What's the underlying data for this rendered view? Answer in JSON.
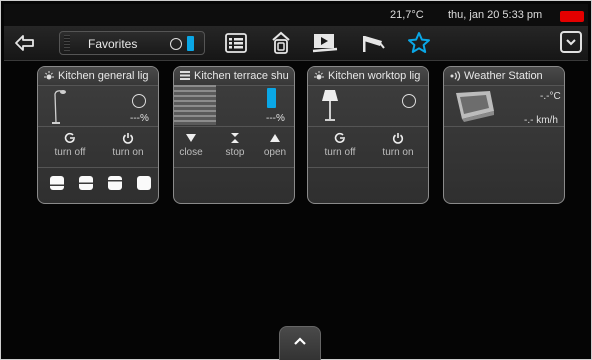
{
  "status_bar": {
    "temperature": "21,7°C",
    "datetime": "thu, jan 20  5:33 pm",
    "battery_color": "#e30000"
  },
  "toolbar": {
    "back_icon": "back-arrow-icon",
    "favorites_select": {
      "value": "Favorites"
    },
    "nav_icons": [
      "list-icon",
      "home-icon",
      "media-player-icon",
      "camera-icon",
      "star-icon"
    ],
    "active_icon": "star-icon",
    "active_color": "#0aa7e6",
    "menu_icon": "chevron-down-icon"
  },
  "cards": [
    {
      "title": "Kitchen general lig",
      "icon": "light-bulb-icon",
      "value": "---%",
      "actions": [
        {
          "icon": "power-off-icon",
          "label": "turn off"
        },
        {
          "icon": "power-on-icon",
          "label": "turn on"
        }
      ]
    },
    {
      "title": "Kitchen terrace shu",
      "icon": "shutter-icon",
      "value": "---%",
      "actions": [
        {
          "icon": "arrow-down-icon",
          "label": "close"
        },
        {
          "icon": "stop-icon",
          "label": "stop"
        },
        {
          "icon": "arrow-up-icon",
          "label": "open"
        }
      ]
    },
    {
      "title": "Kitchen worktop lig",
      "icon": "light-bulb-icon",
      "actions": [
        {
          "icon": "power-off-icon",
          "label": "turn off"
        },
        {
          "icon": "power-on-icon",
          "label": "turn on"
        }
      ]
    },
    {
      "title": "Weather Station",
      "icon": "weather-station-icon",
      "temperature": "-.-°C",
      "wind": "-.- km/h"
    }
  ],
  "bottom_button": {
    "icon": "chevron-up-icon"
  }
}
